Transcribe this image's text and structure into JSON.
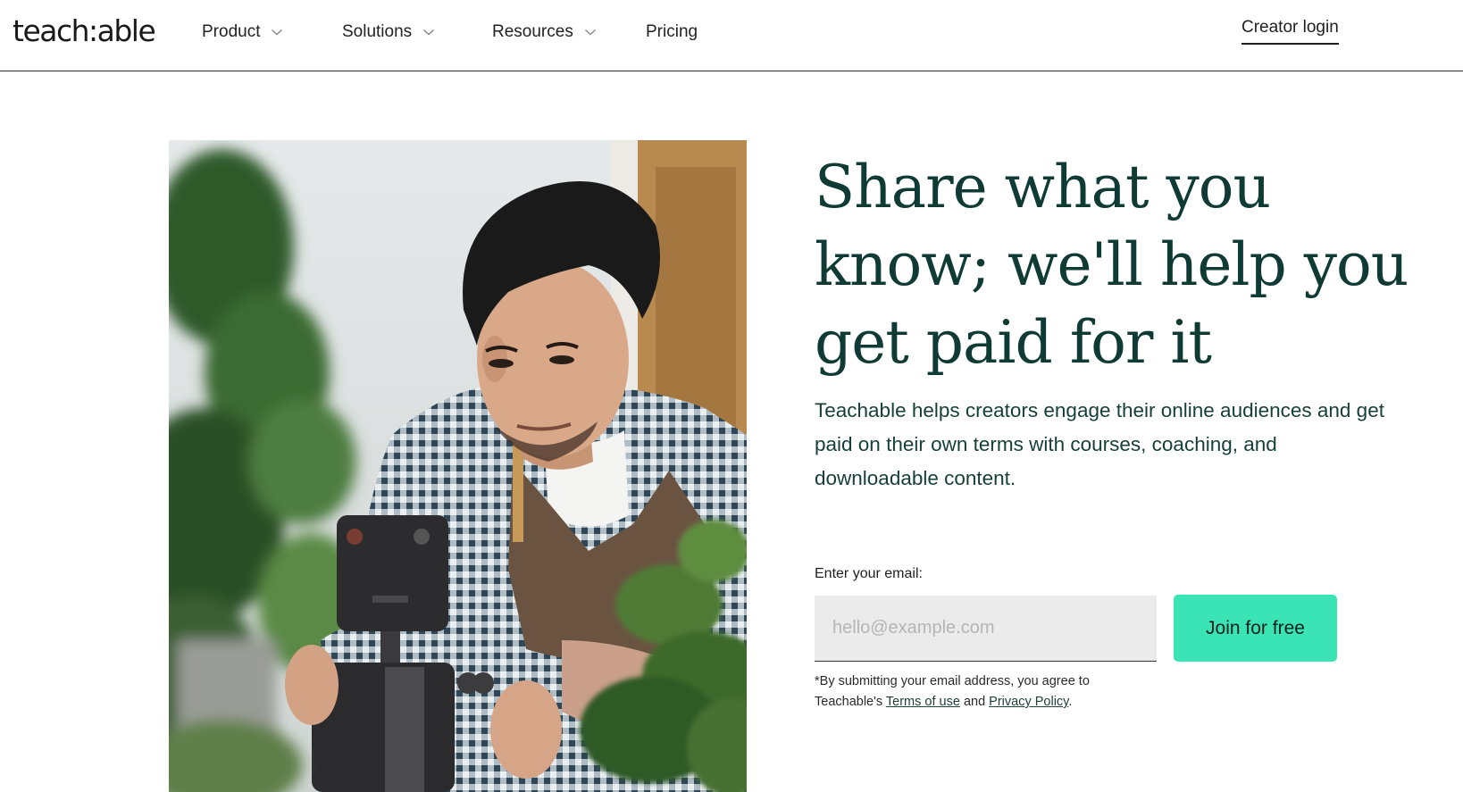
{
  "brand": {
    "logo_text": "teach:able"
  },
  "nav": {
    "items": [
      {
        "label": "Product",
        "has_dropdown": true
      },
      {
        "label": "Solutions",
        "has_dropdown": true
      },
      {
        "label": "Resources",
        "has_dropdown": true
      },
      {
        "label": "Pricing",
        "has_dropdown": false
      }
    ],
    "creator_login": "Creator login"
  },
  "hero": {
    "headline": "Share what you know; we'll help you get paid for it",
    "subtext": "Teachable helps creators engage their online audiences and get paid on their own terms with courses, coaching, and downloadable content.",
    "email_label": "Enter your email:",
    "email_placeholder": "hello@example.com",
    "email_value": "",
    "cta_label": "Join for free",
    "disclaimer": {
      "prefix": "*By submitting your email address, you agree to Teachable's",
      "terms_link": "Terms of use",
      "connector": "and",
      "privacy_link": "Privacy Policy",
      "suffix": "."
    }
  },
  "colors": {
    "headline": "#0f3b34",
    "cta_background": "#3be4b5",
    "input_background": "#ebebeb"
  },
  "icons": {
    "nav_dropdown": "chevron-down-icon"
  }
}
